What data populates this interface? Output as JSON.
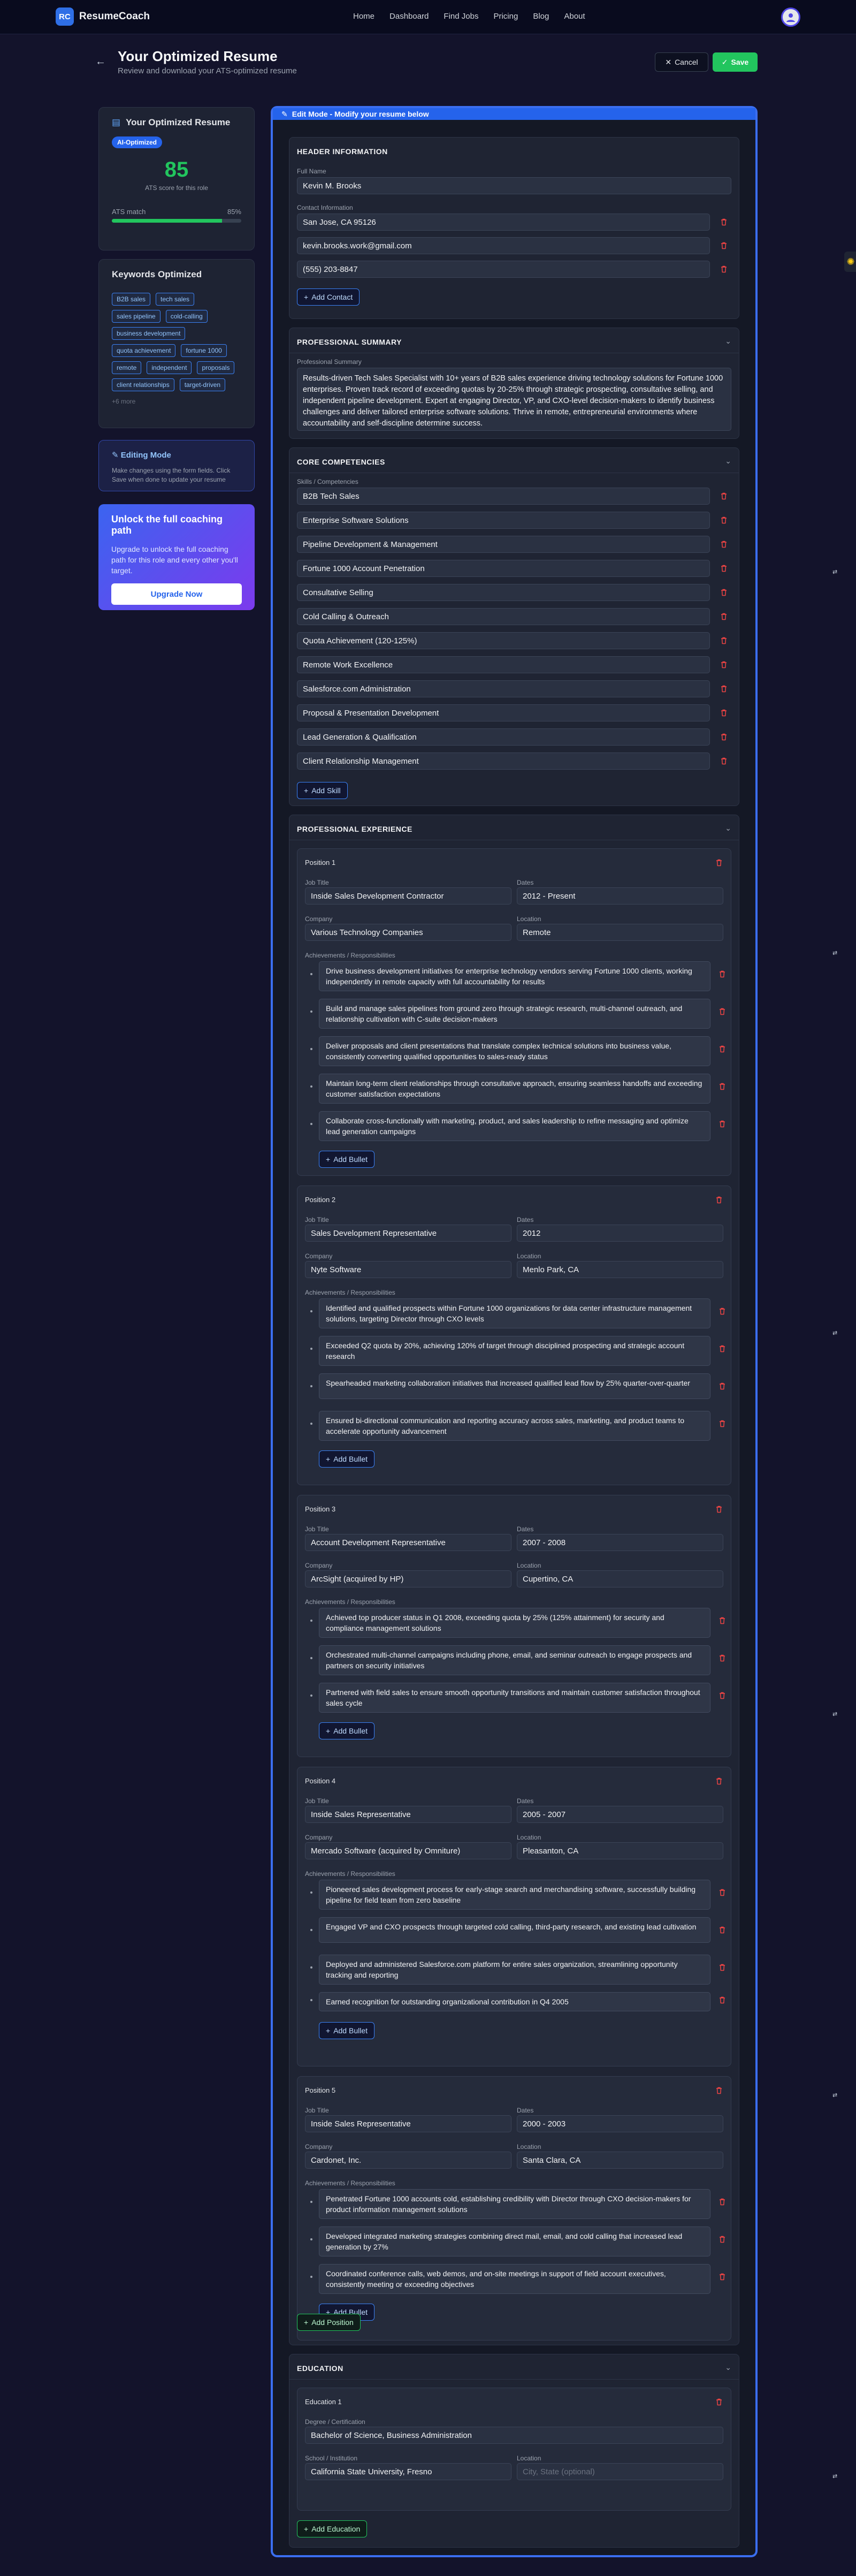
{
  "nav": {
    "logo_mark": "RC",
    "brand": "ResumeCoach",
    "links": [
      "Home",
      "Dashboard",
      "Find Jobs",
      "Pricing",
      "Blog",
      "About"
    ]
  },
  "header": {
    "title": "Your Optimized Resume",
    "subtitle": "Review and download your ATS-optimized resume",
    "cancel_label": "Cancel",
    "save_label": "Save"
  },
  "sidebar": {
    "resume_card": {
      "title": "Your Optimized Resume",
      "badge": "AI-Optimized",
      "score": "85",
      "score_label": "ATS score for this role",
      "match_label": "ATS match",
      "match_value": "85%",
      "match_fraction": 0.85
    },
    "keywords_card": {
      "title": "Keywords Optimized",
      "keywords": [
        "B2B sales",
        "tech sales",
        "sales pipeline",
        "cold-calling",
        "business development",
        "quota achievement",
        "fortune 1000",
        "remote",
        "independent",
        "proposals",
        "client relationships",
        "target-driven"
      ],
      "more": "+6 more"
    },
    "editing_card": {
      "title": "Editing Mode",
      "text": "Make changes using the form fields. Click Save when done to update your resume"
    },
    "upgrade_card": {
      "title": "Unlock the full coaching path",
      "text": "Upgrade to unlock the full coaching path for this role and every other you'll target.",
      "button": "Upgrade Now"
    }
  },
  "editor": {
    "banner": "Edit Mode - Modify your resume below",
    "header_info": {
      "title": "HEADER INFORMATION",
      "full_name_label": "Full Name",
      "full_name": "Kevin M. Brooks",
      "contact_label": "Contact Information",
      "contacts": [
        "San Jose, CA 95126",
        "kevin.brooks.work@gmail.com",
        "(555) 203-8847"
      ],
      "add_contact": "Add Contact"
    },
    "summary": {
      "title": "PROFESSIONAL SUMMARY",
      "label": "Professional Summary",
      "text": "Results-driven Tech Sales Specialist with 10+ years of B2B sales experience driving technology solutions for Fortune 1000 enterprises. Proven track record of exceeding quotas by 20-25% through strategic prospecting, consultative selling, and independent pipeline development. Expert at engaging Director, VP, and CXO-level decision-makers to identify business challenges and deliver tailored enterprise software solutions. Thrive in remote, entrepreneurial environments where accountability and self-discipline determine success."
    },
    "competencies": {
      "title": "CORE COMPETENCIES",
      "label": "Skills / Competencies",
      "skills": [
        "B2B Tech Sales",
        "Enterprise Software Solutions",
        "Pipeline Development & Management",
        "Fortune 1000 Account Penetration",
        "Consultative Selling",
        "Cold Calling & Outreach",
        "Quota Achievement (120-125%)",
        "Remote Work Excellence",
        "Salesforce.com Administration",
        "Proposal & Presentation Development",
        "Lead Generation & Qualification",
        "Client Relationship Management"
      ],
      "add_skill": "Add Skill"
    },
    "experience": {
      "title": "PROFESSIONAL EXPERIENCE",
      "job_title_label": "Job Title",
      "dates_label": "Dates",
      "company_label": "Company",
      "location_label": "Location",
      "bullets_label": "Achievements / Responsibilities",
      "add_bullet": "Add Bullet",
      "add_position": "Add Position",
      "positions": [
        {
          "heading": "Position 1",
          "job_title": "Inside Sales Development Contractor",
          "dates": "2012 - Present",
          "company": "Various Technology Companies",
          "location": "Remote",
          "bullets": [
            "Drive business development initiatives for enterprise technology vendors serving Fortune 1000 clients, working independently in remote capacity with full accountability for results",
            "Build and manage sales pipelines from ground zero through strategic research, multi-channel outreach, and relationship cultivation with C-suite decision-makers",
            "Deliver proposals and client presentations that translate complex technical solutions into business value, consistently converting qualified opportunities to sales-ready status",
            "Maintain long-term client relationships through consultative approach, ensuring seamless handoffs and exceeding customer satisfaction expectations",
            "Collaborate cross-functionally with marketing, product, and sales leadership to refine messaging and optimize lead generation campaigns"
          ]
        },
        {
          "heading": "Position 2",
          "job_title": "Sales Development Representative",
          "dates": "2012",
          "company": "Nyte Software",
          "location": "Menlo Park, CA",
          "bullets": [
            "Identified and qualified prospects within Fortune 1000 organizations for data center infrastructure management solutions, targeting Director through CXO levels",
            "Exceeded Q2 quota by 20%, achieving 120% of target through disciplined prospecting and strategic account research",
            "Spearheaded marketing collaboration initiatives that increased qualified lead flow by 25% quarter-over-quarter",
            "Ensured bi-directional communication and reporting accuracy across sales, marketing, and product teams to accelerate opportunity advancement"
          ]
        },
        {
          "heading": "Position 3",
          "job_title": "Account Development Representative",
          "dates": "2007 - 2008",
          "company": "ArcSight (acquired by HP)",
          "location": "Cupertino, CA",
          "bullets": [
            "Achieved top producer status in Q1 2008, exceeding quota by 25% (125% attainment) for security and compliance management solutions",
            "Orchestrated multi-channel campaigns including phone, email, and seminar outreach to engage prospects and partners on security initiatives",
            "Partnered with field sales to ensure smooth opportunity transitions and maintain customer satisfaction throughout sales cycle"
          ]
        },
        {
          "heading": "Position 4",
          "job_title": "Inside Sales Representative",
          "dates": "2005 - 2007",
          "company": "Mercado Software (acquired by Omniture)",
          "location": "Pleasanton, CA",
          "bullets": [
            "Pioneered sales development process for early-stage search and merchandising software, successfully building pipeline for field team from zero baseline",
            "Engaged VP and CXO prospects through targeted cold calling, third-party research, and existing lead cultivation",
            "Deployed and administered Salesforce.com platform for entire sales organization, streamlining opportunity tracking and reporting",
            "Earned recognition for outstanding organizational contribution in Q4 2005"
          ]
        },
        {
          "heading": "Position 5",
          "job_title": "Inside Sales Representative",
          "dates": "2000 - 2003",
          "company": "Cardonet, Inc.",
          "location": "Santa Clara, CA",
          "bullets": [
            "Penetrated Fortune 1000 accounts cold, establishing credibility with Director through CXO decision-makers for product information management solutions",
            "Developed integrated marketing strategies combining direct mail, email, and cold calling that increased lead generation by 27%",
            "Coordinated conference calls, web demos, and on-site meetings in support of field account executives, consistently meeting or exceeding objectives"
          ]
        }
      ]
    },
    "education": {
      "title": "EDUCATION",
      "heading": "Education 1",
      "degree_label": "Degree / Certification",
      "degree": "Bachelor of Science, Business Administration",
      "school_label": "School / Institution",
      "school": "California State University, Fresno",
      "location_label": "Location",
      "location_placeholder": "City, State (optional)",
      "add_education": "Add Education"
    }
  }
}
